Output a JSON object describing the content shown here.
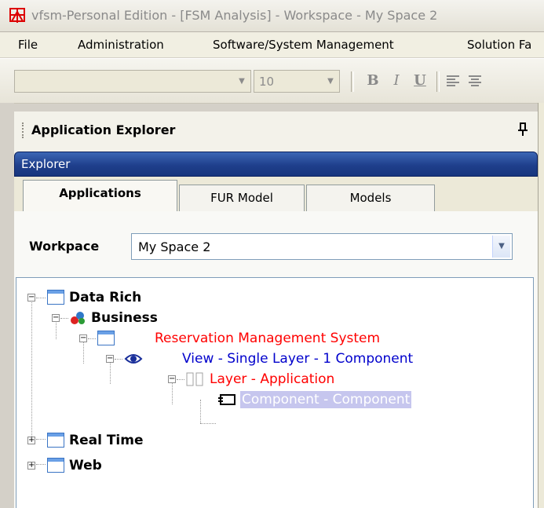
{
  "window": {
    "title": "vfsm-Personal Edition - [FSM Analysis] - Workspace - My Space 2"
  },
  "menu": {
    "items": [
      "File",
      "Administration",
      "Software/System Management",
      "Solution Fa"
    ]
  },
  "toolbar": {
    "font_name": "",
    "font_size": "10",
    "bold_label": "B",
    "italic_label": "I",
    "underline_label": "U"
  },
  "panel": {
    "title": "Application Explorer",
    "explorer_label": "Explorer",
    "tabs": [
      "Applications",
      "FUR Model",
      "Models"
    ],
    "active_tab": "Applications"
  },
  "workspace": {
    "label": "Workpace",
    "value": "My Space 2"
  },
  "tree": {
    "data_rich": "Data Rich",
    "business": "Business",
    "reservation": "Reservation Management System",
    "view": "View - Single  Layer - 1 Component",
    "layer": "Layer - Application",
    "component": "Component - Component",
    "real_time": "Real Time",
    "web": "Web"
  },
  "colors": {
    "red_text": "#ff0000",
    "blue_text": "#0000cc",
    "selection": "#c6c6ee",
    "explorer_bar": "#1f3f8c"
  }
}
